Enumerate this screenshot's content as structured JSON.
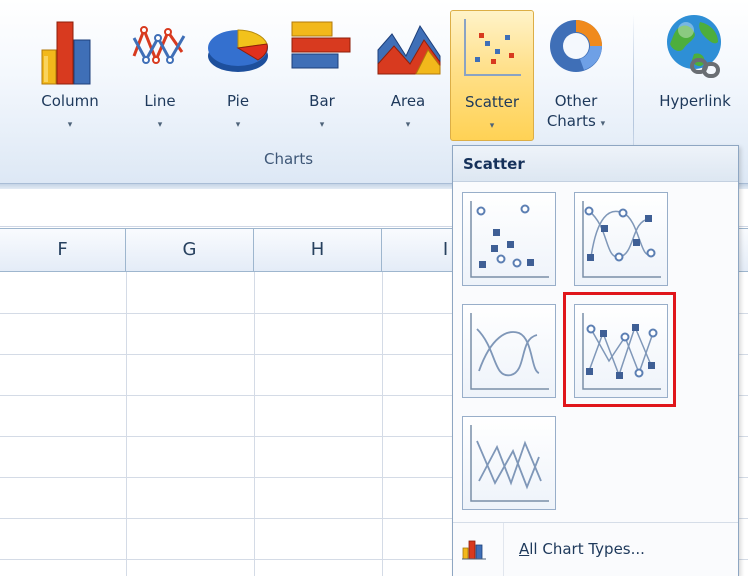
{
  "ribbon": {
    "buttons": [
      {
        "label": "Column",
        "icon": "column-chart-icon",
        "has_dropdown": true
      },
      {
        "label": "Line",
        "icon": "line-chart-icon",
        "has_dropdown": true
      },
      {
        "label": "Pie",
        "icon": "pie-chart-icon",
        "has_dropdown": true
      },
      {
        "label": "Bar",
        "icon": "bar-chart-icon",
        "has_dropdown": true
      },
      {
        "label": "Area",
        "icon": "area-chart-icon",
        "has_dropdown": true
      },
      {
        "label": "Scatter",
        "icon": "scatter-chart-icon",
        "has_dropdown": true,
        "active": true
      },
      {
        "label_line1": "Other",
        "label_line2": "Charts",
        "icon": "doughnut-chart-icon",
        "has_dropdown": true
      },
      {
        "label": "Hyperlink",
        "icon": "globe-link-icon",
        "has_dropdown": false
      }
    ],
    "group_label": "Charts",
    "dropdown_arrow": "▾"
  },
  "sheet": {
    "columns": [
      "F",
      "G",
      "H",
      "I"
    ]
  },
  "scatter_menu": {
    "title": "Scatter",
    "options": [
      {
        "icon": "scatter-markers-only-icon"
      },
      {
        "icon": "scatter-smooth-lines-markers-icon"
      },
      {
        "icon": "scatter-smooth-lines-icon"
      },
      {
        "icon": "scatter-straight-lines-markers-icon",
        "highlighted": true
      },
      {
        "icon": "scatter-straight-lines-icon"
      }
    ],
    "footer": {
      "label_first": "A",
      "label_rest": "ll Chart Types...",
      "icon": "all-chart-types-icon"
    }
  },
  "colors": {
    "accent_active": "#ffd255",
    "highlight_box": "#e0161b",
    "ribbon_text": "#1e395b"
  }
}
